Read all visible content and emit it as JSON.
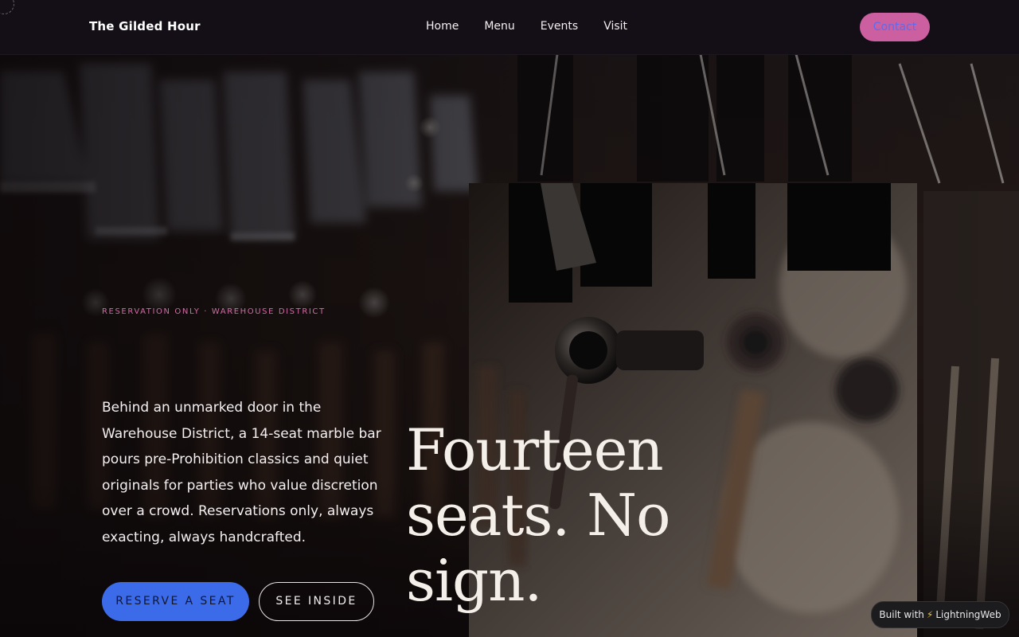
{
  "header": {
    "brand": "The Gilded Hour",
    "nav": [
      "Home",
      "Menu",
      "Events",
      "Visit"
    ],
    "contact_label": "Contact"
  },
  "hero": {
    "eyebrow": "RESERVATION ONLY · WAREHOUSE DISTRICT",
    "lede": "Behind an unmarked door in the Warehouse District, a 14-seat marble bar pours pre-Prohibition classics and quiet originals for parties who value discretion over a crowd. Reservations only, always exacting, always handcrafted.",
    "headline_lines": [
      "Fourteen",
      "seats. No",
      "sign."
    ],
    "primary_cta": "RESERVE A SEAT",
    "secondary_cta": "SEE INSIDE"
  },
  "badge": {
    "prefix": "Built with",
    "icon": "lightning-bolt-icon",
    "name": "LightningWeb"
  },
  "colors": {
    "accent_pink": "#cc5fa0",
    "eyebrow_pink": "#d26aa6",
    "primary_blue": "#3c6bea",
    "header_bg": "#140f16"
  }
}
